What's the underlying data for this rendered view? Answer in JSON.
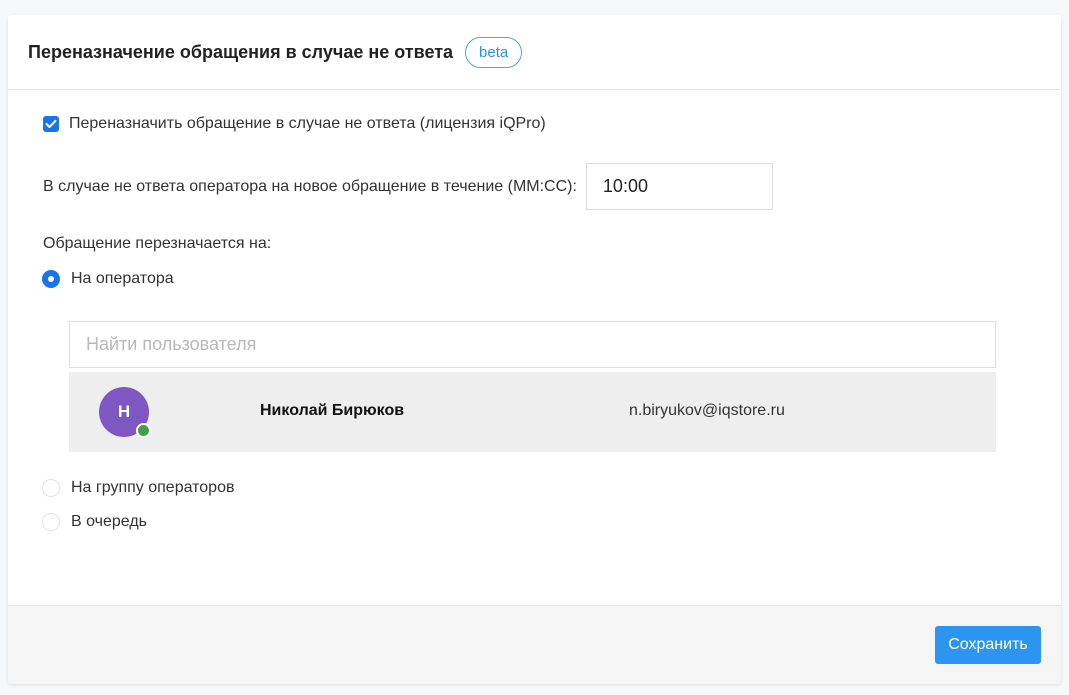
{
  "header": {
    "title": "Переназначение обращения в случае не ответа",
    "badge": "beta"
  },
  "reassign_checkbox": {
    "label": "Переназначить обращение в случае не ответа (лицензия iQPro)",
    "checked": true
  },
  "timeout": {
    "label": "В случае не ответа оператора на новое обращение в течение (ММ:СС):",
    "value": "10:00"
  },
  "assign_to": {
    "label": "Обращение перезначается на:",
    "options": [
      {
        "label": "На оператора",
        "checked": true
      },
      {
        "label": "На группу операторов",
        "checked": false
      },
      {
        "label": "В очередь",
        "checked": false
      }
    ]
  },
  "user_search": {
    "placeholder": "Найти пользователя"
  },
  "users": [
    {
      "initial": "Н",
      "name": "Николай Бирюков",
      "email": "n.biryukov@iqstore.ru",
      "online": true
    }
  ],
  "footer": {
    "save_label": "Сохранить"
  },
  "colors": {
    "accent": "#1a73e8",
    "button": "#2b95f0",
    "avatar": "#7e57c2",
    "online": "#43a047",
    "badge_border": "#4aa6e6"
  }
}
